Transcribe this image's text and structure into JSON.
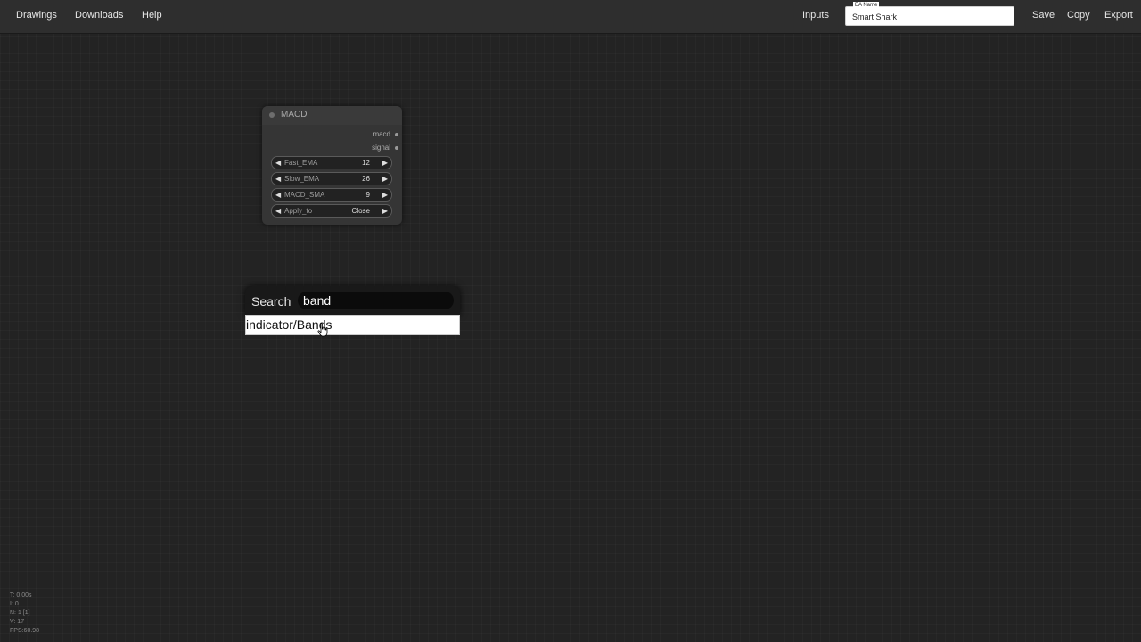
{
  "menu": {
    "items": [
      "Drawings",
      "Downloads",
      "Help"
    ]
  },
  "toolbar": {
    "inputs_label": "Inputs",
    "ea_name_legend": "EA Name",
    "ea_name_value": "Smart Shark",
    "save_label": "Save",
    "copy_label": "Copy",
    "export_label": "Export"
  },
  "node": {
    "title": "MACD",
    "outputs": [
      "macd",
      "signal"
    ],
    "widgets": [
      {
        "label": "Fast_EMA",
        "value": "12"
      },
      {
        "label": "Slow_EMA",
        "value": "26"
      },
      {
        "label": "MACD_SMA",
        "value": "9"
      },
      {
        "label": "Apply_to",
        "value": "Close"
      }
    ]
  },
  "search": {
    "label": "Search",
    "value": "band",
    "results": [
      "indicator/Bands"
    ]
  },
  "stats": {
    "t": "T: 0.00s",
    "i": "I: 0",
    "n": "N: 1 [1]",
    "v": "V: 17",
    "fps": "FPS:60.98"
  },
  "colors": {
    "background": "#232323",
    "topbar": "#2e2e2e",
    "node_body": "#353535"
  }
}
